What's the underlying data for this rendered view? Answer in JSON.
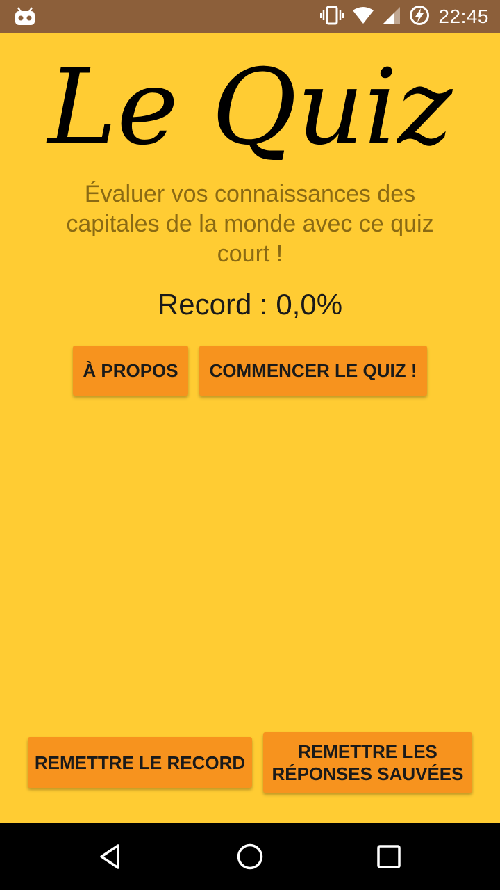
{
  "status_bar": {
    "time": "22:45",
    "icons": [
      "debug-icon",
      "vibrate-icon",
      "wifi-icon",
      "signal-icon",
      "battery-charging-icon"
    ],
    "background": "#8C5F3A"
  },
  "main": {
    "title": "Le Quiz",
    "subtitle": "Évaluer vos connaissances des capitales de la monde avec ce quiz court !",
    "record": "Record : 0,0%",
    "background": "#FFCC33",
    "subtitle_color": "#8A6A14"
  },
  "buttons": {
    "about": "À PROPOS",
    "start": "COMMENCER LE QUIZ !",
    "reset_record": "REMETTRE LE RECORD",
    "reset_answers": "REMETTRE LES RÉPONSES SAUVÉES",
    "color": "#F7931E"
  },
  "nav_bar": {
    "icons": [
      "back-icon",
      "home-icon",
      "recents-icon"
    ]
  }
}
